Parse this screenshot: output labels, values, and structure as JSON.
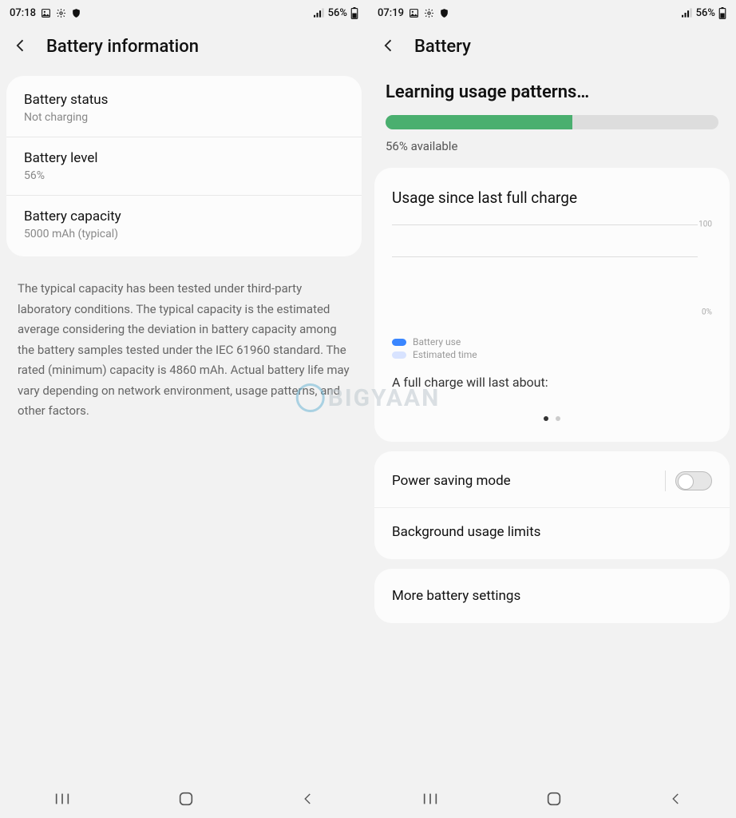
{
  "left": {
    "status": {
      "time": "07:18",
      "battery": "56%"
    },
    "title": "Battery information",
    "rows": [
      {
        "title": "Battery status",
        "sub": "Not charging"
      },
      {
        "title": "Battery level",
        "sub": "56%"
      },
      {
        "title": "Battery capacity",
        "sub": "5000 mAh (typical)"
      }
    ],
    "description": "The typical capacity has been tested under third-party laboratory conditions. The typical capacity is the estimated average considering the deviation in battery capacity among the battery samples tested under the IEC 61960 standard. The rated (minimum) capacity is 4860 mAh. Actual battery life may vary depending on network environment, usage patterns, and other factors."
  },
  "right": {
    "status": {
      "time": "07:19",
      "battery": "56%"
    },
    "title": "Battery",
    "learning_title": "Learning usage patterns…",
    "progress_percent": 56,
    "available_text": "56% available",
    "usage_title": "Usage since last full charge",
    "chart": {
      "y_top": "100",
      "y_bottom": "0%"
    },
    "legend": {
      "use": "Battery use",
      "est": "Estimated time",
      "use_color": "#3a86ff",
      "est_color": "#d8e3ff"
    },
    "full_charge_text": "A full charge will last about:",
    "options": {
      "power_saving": "Power saving mode",
      "bg_limits": "Background usage limits",
      "more": "More battery settings"
    }
  },
  "watermark": "BIGYAAN"
}
